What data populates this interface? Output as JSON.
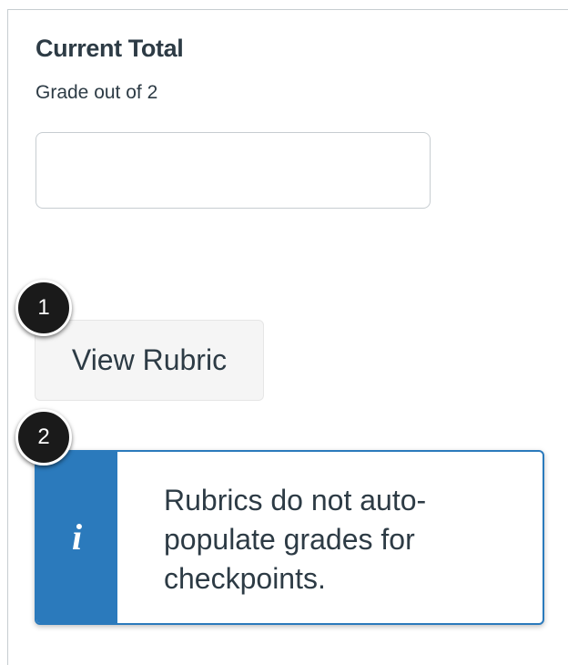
{
  "grade": {
    "title": "Current Total",
    "subtitle": "Grade out of 2",
    "input_value": ""
  },
  "rubric": {
    "button_label": "View Rubric"
  },
  "alert": {
    "icon": "info-icon",
    "message": "Rubrics do not auto-populate grades for checkpoints."
  },
  "callouts": [
    "1",
    "2"
  ],
  "colors": {
    "text": "#2d3b45",
    "info_blue": "#2b7abc",
    "border": "#c7cdd1",
    "button_bg": "#f5f5f5",
    "callout_bg": "#1a1a1a"
  }
}
